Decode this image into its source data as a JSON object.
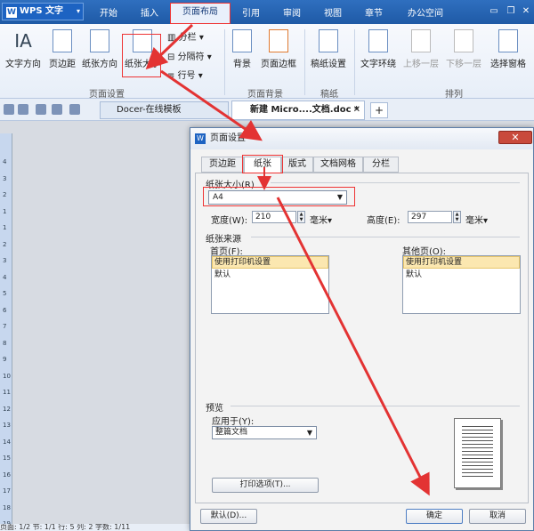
{
  "app": {
    "logo_label": "WPS 文字"
  },
  "menu": {
    "tabs": [
      "开始",
      "插入",
      "页面布局",
      "引用",
      "审阅",
      "视图",
      "章节",
      "办公空间"
    ],
    "active_tab": "页面布局"
  },
  "ribbon": {
    "text_direction": "文字方向",
    "margins": "页边距",
    "orientation": "纸张方向",
    "paper_size": "纸张大小",
    "columns": "分栏",
    "breaks": "分隔符",
    "line_numbers": "行号",
    "background": "背景",
    "page_border": "页面边框",
    "grid_setup": "稿纸设置",
    "text_wrap": "文字环绕",
    "bring_forward": "上移一层",
    "send_backward": "下移一层",
    "selection_pane": "选择窗格",
    "group_page_setup": "页面设置",
    "group_page_background": "页面背景",
    "group_grid": "稿纸",
    "group_arrange": "排列"
  },
  "doc_tabs": {
    "docer": "Docer-在线模板",
    "new_doc": "新建 Micro....文档.doc *"
  },
  "ruler": {
    "numbers": [
      "4",
      "3",
      "2",
      "1",
      "1",
      "2",
      "3",
      "4",
      "5",
      "6",
      "7",
      "8",
      "9",
      "10",
      "11",
      "12",
      "13",
      "14",
      "15",
      "16",
      "17",
      "18",
      "19"
    ]
  },
  "status": {
    "text": "页面: 1/2  节: 1/1  行: 5  列: 2  字数: 1/11"
  },
  "dialog": {
    "title": "页面设置",
    "close_label": "✕",
    "tabs": [
      "页边距",
      "纸张",
      "版式",
      "文档网格",
      "分栏"
    ],
    "active_tab": "纸张",
    "paper_size_label": "纸张大小(R)",
    "paper_size_value": "A4",
    "width_label": "宽度(W):",
    "width_value": "210",
    "width_unit": "毫米▾",
    "height_label": "高度(E):",
    "height_value": "297",
    "height_unit": "毫米▾",
    "paper_source_label": "纸张来源",
    "first_page_label": "首页(F):",
    "first_page_items": [
      "使用打印机设置",
      "默认"
    ],
    "other_pages_label": "其他页(O):",
    "other_pages_items": [
      "使用打印机设置",
      "默认"
    ],
    "preview_label": "预览",
    "apply_to_label": "应用于(Y):",
    "apply_to_value": "整篇文档",
    "print_options_button": "打印选项(T)...",
    "default_button": "默认(D)...",
    "ok_button": "确定",
    "cancel_button": "取消"
  },
  "colors": {
    "highlight": "#e33333",
    "menubar": "#2f6fbf"
  }
}
